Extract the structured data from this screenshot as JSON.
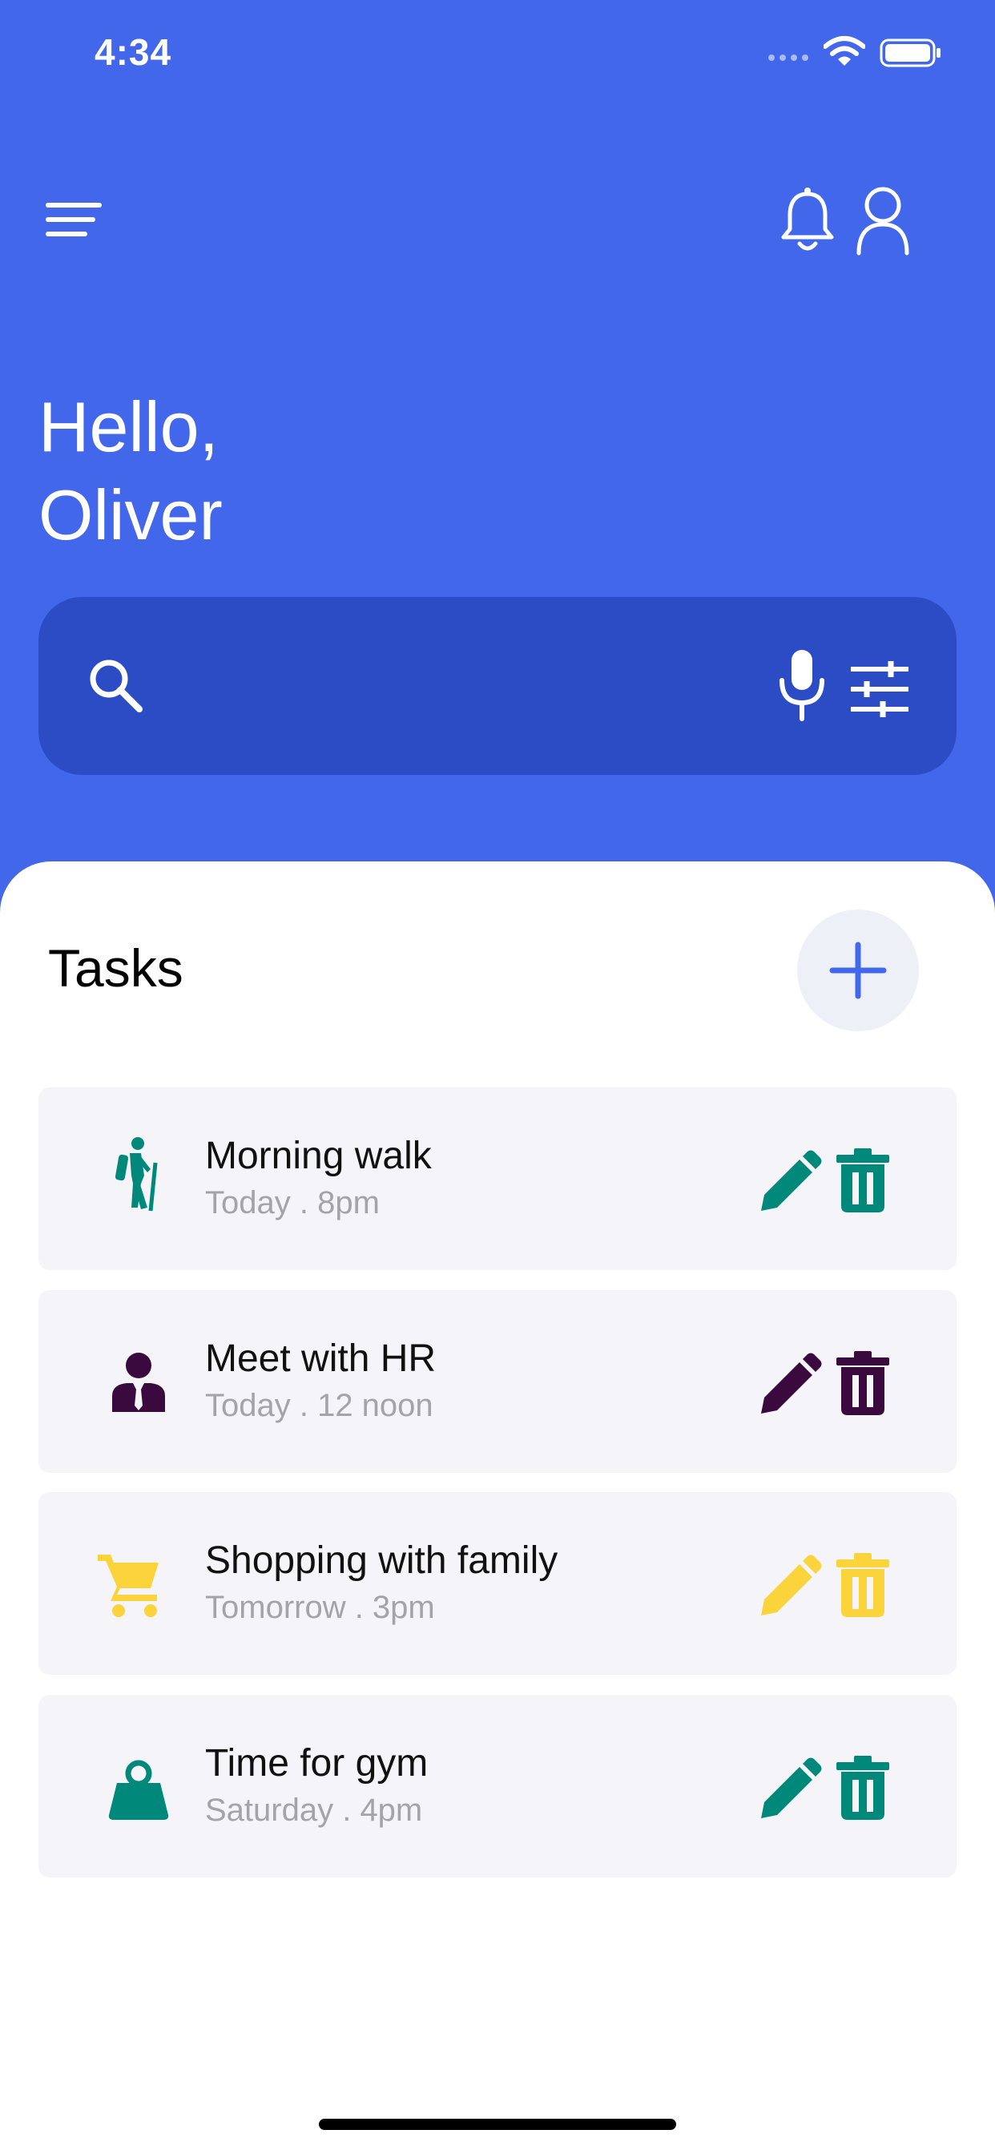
{
  "status_bar": {
    "time": "4:34"
  },
  "greeting": {
    "line1": "Hello,",
    "line2": "Oliver"
  },
  "header_icons": [
    "menu-icon",
    "bell-icon",
    "user-icon"
  ],
  "search": {
    "icons": [
      "search-icon",
      "mic-icon",
      "filter-icon"
    ]
  },
  "tasks_section": {
    "heading": "Tasks",
    "add_icon": "plus-icon",
    "items": [
      {
        "title": "Morning walk",
        "time": "Today . 8pm",
        "icon": "hiking-icon",
        "color": "#00897b"
      },
      {
        "title": "Meet with HR",
        "time": "Today . 12 noon",
        "icon": "businessman-icon",
        "color": "#3a0a3f"
      },
      {
        "title": "Shopping with family",
        "time": "Tomorrow . 3pm",
        "icon": "cart-icon",
        "color": "#fbd43c"
      },
      {
        "title": "Time for gym",
        "time": "Saturday . 4pm",
        "icon": "weight-icon",
        "color": "#00897b"
      }
    ]
  },
  "colors": {
    "primary": "#4267ea",
    "search_bg": "#2c4cc6",
    "card_bg": "#f4f4f9",
    "secondary_text": "#a3a3a8"
  }
}
